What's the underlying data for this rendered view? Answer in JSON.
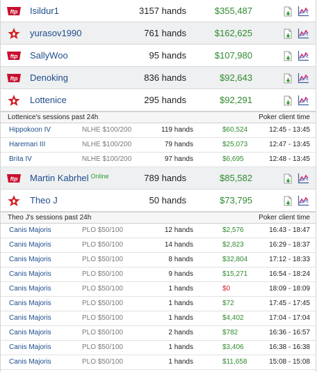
{
  "players_top": [
    {
      "name": "Isildur1",
      "logo": "fulltilt-logo",
      "hands": "3157 hands",
      "profit": "$355,487",
      "shaded": false
    },
    {
      "name": "yurasov1990",
      "logo": "pokerstars-logo",
      "hands": "761 hands",
      "profit": "$162,625",
      "shaded": true
    },
    {
      "name": "SallyWoo",
      "logo": "fulltilt-logo",
      "hands": "95 hands",
      "profit": "$107,980",
      "shaded": false
    },
    {
      "name": "Denoking",
      "logo": "fulltilt-logo",
      "hands": "836 hands",
      "profit": "$92,643",
      "shaded": true
    },
    {
      "name": "Lottenice",
      "logo": "pokerstars-logo",
      "hands": "295 hands",
      "profit": "$92,291",
      "shaded": false
    }
  ],
  "lottenice_sessions": {
    "title": "Lottenice's sessions past 24h",
    "time_label": "Poker client time",
    "rows": [
      {
        "name": "Hippokoon IV",
        "game": "NLHE $100/200",
        "hands": "119 hands",
        "profit": "$60,524",
        "time": "12:45 - 13:45"
      },
      {
        "name": "Haremari III",
        "game": "NLHE $100/200",
        "hands": "79 hands",
        "profit": "$25,073",
        "time": "12:47 - 13:45"
      },
      {
        "name": "Brita IV",
        "game": "NLHE $100/200",
        "hands": "97 hands",
        "profit": "$6,695",
        "time": "12:48 - 13:45"
      }
    ]
  },
  "players_mid": [
    {
      "name": "Martin Kabrhel",
      "online": "Online",
      "logo": "fulltilt-logo",
      "hands": "789 hands",
      "profit": "$85,582",
      "shaded": true
    },
    {
      "name": "Theo J",
      "logo": "pokerstars-logo",
      "hands": "50 hands",
      "profit": "$73,795",
      "shaded": false
    }
  ],
  "theoj_sessions": {
    "title": "Theo J's sessions past 24h",
    "time_label": "Poker client time",
    "rows": [
      {
        "name": "Canis Majoris",
        "game": "PLO $50/100",
        "hands": "12 hands",
        "profit": "$2,576",
        "time": "16:43 - 18:47"
      },
      {
        "name": "Canis Majoris",
        "game": "PLO $50/100",
        "hands": "14 hands",
        "profit": "$2,823",
        "time": "16:29 - 18:37"
      },
      {
        "name": "Canis Majoris",
        "game": "PLO $50/100",
        "hands": "8 hands",
        "profit": "$32,804",
        "time": "17:12 - 18:33"
      },
      {
        "name": "Canis Majoris",
        "game": "PLO $50/100",
        "hands": "9 hands",
        "profit": "$15,271",
        "time": "16:54 - 18:24"
      },
      {
        "name": "Canis Majoris",
        "game": "PLO $50/100",
        "hands": "1 hands",
        "profit": "$0",
        "time": "18:09 - 18:09",
        "zero": true
      },
      {
        "name": "Canis Majoris",
        "game": "PLO $50/100",
        "hands": "1 hands",
        "profit": "$72",
        "time": "17:45 - 17:45"
      },
      {
        "name": "Canis Majoris",
        "game": "PLO $50/100",
        "hands": "1 hands",
        "profit": "$4,402",
        "time": "17:04 - 17:04"
      },
      {
        "name": "Canis Majoris",
        "game": "PLO $50/100",
        "hands": "2 hands",
        "profit": "$782",
        "time": "16:36 - 16:57"
      },
      {
        "name": "Canis Majoris",
        "game": "PLO $50/100",
        "hands": "1 hands",
        "profit": "$3,406",
        "time": "16:38 - 16:38"
      },
      {
        "name": "Canis Majoris",
        "game": "PLO $50/100",
        "hands": "1 hands",
        "profit": "$11,658",
        "time": "15:08 - 15:08"
      }
    ]
  },
  "colors": {
    "profit_positive": "#2f8a2f",
    "profit_zero": "#d32020",
    "player_link": "#1e4d8c",
    "online": "#2e9a2e"
  }
}
